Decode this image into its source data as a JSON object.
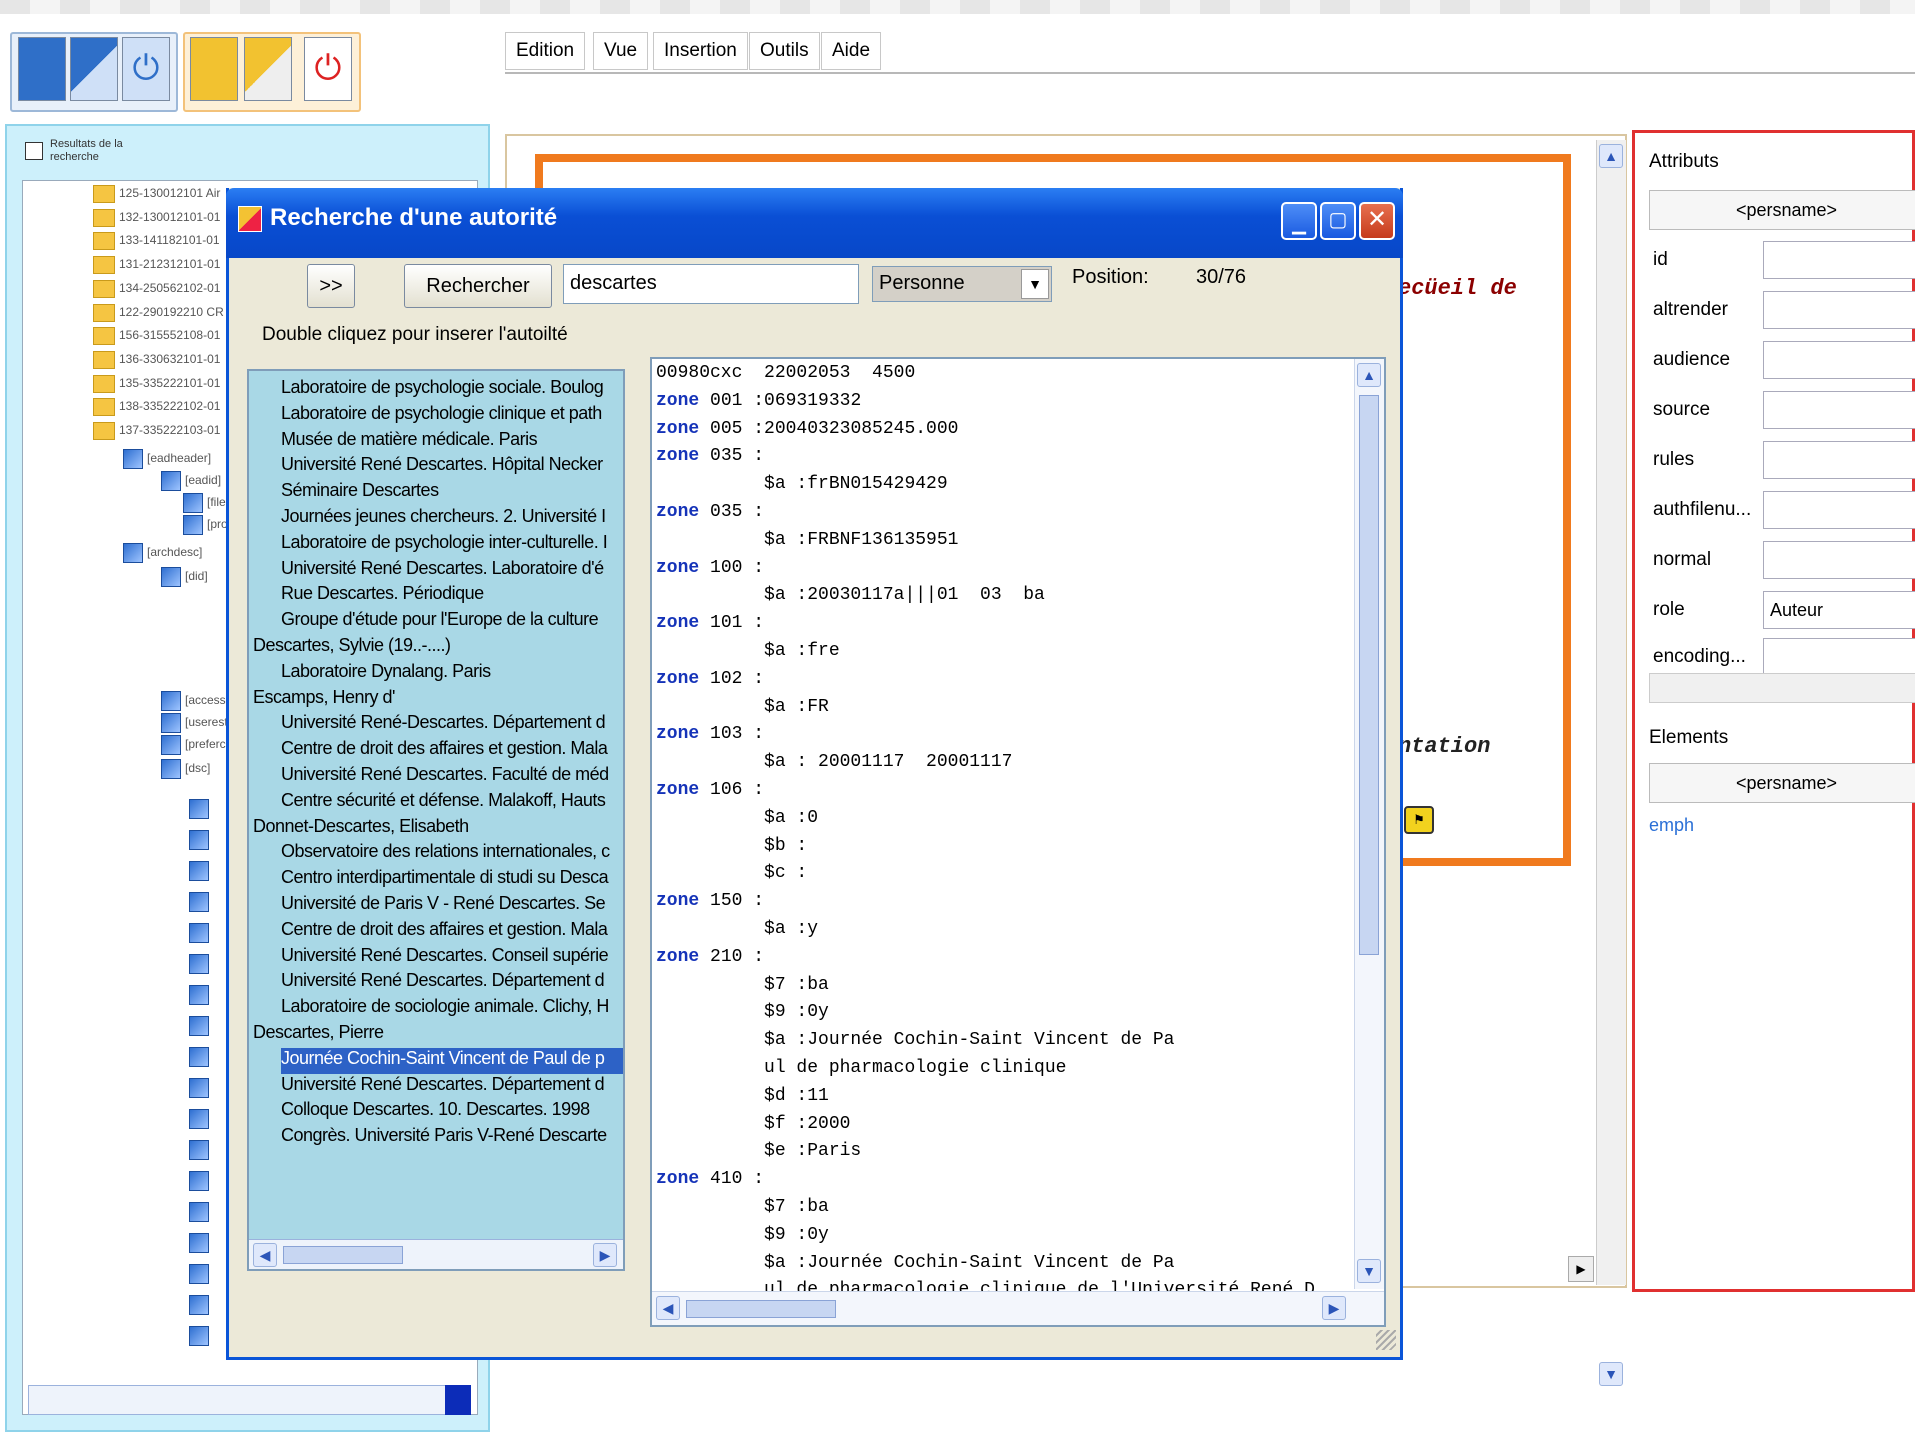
{
  "menu": [
    "Edition",
    "Vue",
    "Insertion",
    "Outils",
    "Aide"
  ],
  "left_panel": {
    "checkbox_label": "Resultats de la recherche",
    "tree_rows": [
      "125-130012101 Air",
      "132-130012101-01",
      "133-141182101-01",
      "131-212312101-01",
      "134-250562102-01",
      "122-290192210 CR",
      "156-315552108-01",
      "136-330632101-01",
      "135-335222101-01",
      "138-335222102-01",
      "137-335222103-01"
    ],
    "sub_rows": [
      "[eadheader]",
      "[eadid]",
      "[filedesc]",
      "[profiledesc]",
      "[archdesc]",
      "[did]",
      "[accessrestrict]",
      "[userestrict]",
      "[prefercite]",
      "[dsc]"
    ]
  },
  "editor": {
    "partial_text_1": "ecüeil de",
    "partial_text_2": "ntation"
  },
  "attributes": {
    "header": "Attributs",
    "element_name": "<persname>",
    "fields": [
      {
        "label": "id",
        "value": ""
      },
      {
        "label": "altrender",
        "value": ""
      },
      {
        "label": "audience",
        "value": ""
      },
      {
        "label": "source",
        "value": ""
      },
      {
        "label": "rules",
        "value": ""
      },
      {
        "label": "authfilenu...",
        "value": ""
      },
      {
        "label": "normal",
        "value": ""
      },
      {
        "label": "role",
        "value": "Auteur"
      },
      {
        "label": "encoding...",
        "value": ""
      }
    ],
    "elements_header": "Elements",
    "elements_name": "<persname>",
    "link": "emph"
  },
  "dialog": {
    "title": "Recherche d'une autorité",
    "next_label": ">>",
    "search_label": "Rechercher",
    "search_value": "descartes",
    "type_value": "Personne",
    "position_label": "Position:",
    "position_value": "30/76",
    "hint": "Double cliquez pour inserer l'autoilté",
    "results": [
      {
        "t": "Laboratoire de psychologie sociale. Boulog",
        "i": 1
      },
      {
        "t": "Laboratoire de psychologie clinique et path",
        "i": 1
      },
      {
        "t": "Musée de matière médicale. Paris",
        "i": 1
      },
      {
        "t": "Université René Descartes. Hôpital Necker",
        "i": 1
      },
      {
        "t": "Séminaire Descartes",
        "i": 1
      },
      {
        "t": "Journées jeunes chercheurs. 2. Université I",
        "i": 1
      },
      {
        "t": "Laboratoire de psychologie inter-culturelle. I",
        "i": 1
      },
      {
        "t": "Université René Descartes. Laboratoire d'é",
        "i": 1
      },
      {
        "t": "Rue Descartes. Périodique",
        "i": 1
      },
      {
        "t": "Groupe d'étude pour l'Europe de la culture",
        "i": 1
      },
      {
        "t": "Descartes, Sylvie (19..-....)",
        "i": 0
      },
      {
        "t": "Laboratoire Dynalang. Paris",
        "i": 1
      },
      {
        "t": "Escamps, Henry d'",
        "i": 0
      },
      {
        "t": "Université René-Descartes. Département d",
        "i": 1
      },
      {
        "t": "Centre de droit des affaires et gestion. Mala",
        "i": 1
      },
      {
        "t": "Université René Descartes. Faculté de méd",
        "i": 1
      },
      {
        "t": "Centre sécurité et défense. Malakoff, Hauts",
        "i": 1
      },
      {
        "t": "Donnet-Descartes, Elisabeth",
        "i": 0
      },
      {
        "t": "Observatoire des relations internationales, c",
        "i": 1
      },
      {
        "t": "Centro interdipartimentale di studi su Desca",
        "i": 1
      },
      {
        "t": "Université de Paris V - René Descartes. Se",
        "i": 1
      },
      {
        "t": "Centre de droit des affaires et gestion. Mala",
        "i": 1
      },
      {
        "t": "Université René Descartes. Conseil supérie",
        "i": 1
      },
      {
        "t": "Université René Descartes. Département d",
        "i": 1
      },
      {
        "t": "Laboratoire de sociologie animale. Clichy, H",
        "i": 1
      },
      {
        "t": "Descartes, Pierre",
        "i": 0
      },
      {
        "t": "Journée Cochin-Saint Vincent de Paul de p",
        "i": 1,
        "sel": 1
      },
      {
        "t": "Université René Descartes. Département d",
        "i": 1
      },
      {
        "t": "Colloque Descartes. 10. Descartes. 1998",
        "i": 1
      },
      {
        "t": "Congrès. Université Paris V-René Descarte",
        "i": 1
      }
    ],
    "record": [
      {
        "k": "",
        "v": "00980cxc  22002053  4500"
      },
      {
        "k": "zone",
        "v": " 001 :069319332"
      },
      {
        "k": "zone",
        "v": " 005 :20040323085245.000"
      },
      {
        "k": "zone",
        "v": " 035 :"
      },
      {
        "k": "",
        "v": "          $a :frBN015429429"
      },
      {
        "k": "zone",
        "v": " 035 :"
      },
      {
        "k": "",
        "v": "          $a :FRBNF136135951"
      },
      {
        "k": "zone",
        "v": " 100 :"
      },
      {
        "k": "",
        "v": "          $a :20030117a|||01  03  ba"
      },
      {
        "k": "zone",
        "v": " 101 :"
      },
      {
        "k": "",
        "v": "          $a :fre"
      },
      {
        "k": "zone",
        "v": " 102 :"
      },
      {
        "k": "",
        "v": "          $a :FR"
      },
      {
        "k": "zone",
        "v": " 103 :"
      },
      {
        "k": "",
        "v": "          $a : 20001117  20001117"
      },
      {
        "k": "zone",
        "v": " 106 :"
      },
      {
        "k": "",
        "v": "          $a :0"
      },
      {
        "k": "",
        "v": "          $b :"
      },
      {
        "k": "",
        "v": "          $c :"
      },
      {
        "k": "zone",
        "v": " 150 :"
      },
      {
        "k": "",
        "v": "          $a :y"
      },
      {
        "k": "zone",
        "v": " 210 :"
      },
      {
        "k": "",
        "v": "          $7 :ba"
      },
      {
        "k": "",
        "v": "          $9 :0y"
      },
      {
        "k": "",
        "v": "          $a :Journée Cochin-Saint Vincent de Pa"
      },
      {
        "k": "",
        "v": "          ul de pharmacologie clinique"
      },
      {
        "k": "",
        "v": "          $d :11"
      },
      {
        "k": "",
        "v": "          $f :2000"
      },
      {
        "k": "",
        "v": "          $e :Paris"
      },
      {
        "k": "zone",
        "v": " 410 :"
      },
      {
        "k": "",
        "v": "          $7 :ba"
      },
      {
        "k": "",
        "v": "          $9 :0y"
      },
      {
        "k": "",
        "v": "          $a :Journée Cochin-Saint Vincent de Pa"
      },
      {
        "k": "",
        "v": "          ul de pharmacologie clinique de l'Université René D"
      }
    ]
  }
}
